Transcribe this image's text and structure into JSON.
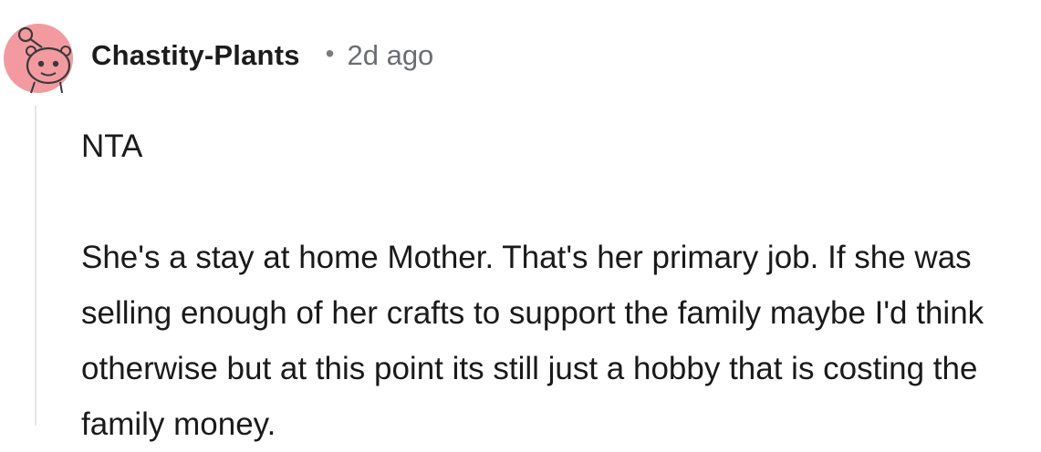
{
  "comment": {
    "author": "Chastity-Plants",
    "separator": "•",
    "timestamp": "2d ago",
    "avatar_icon": "reddit-snoo-avatar-icon",
    "avatar_color": "#f39aa0",
    "paragraphs": [
      "NTA",
      "She's a stay at home Mother. That's her primary job. If she was selling enough of her crafts to support the family maybe I'd think otherwise but at this point its still just a hobby that is costing the family money."
    ]
  }
}
